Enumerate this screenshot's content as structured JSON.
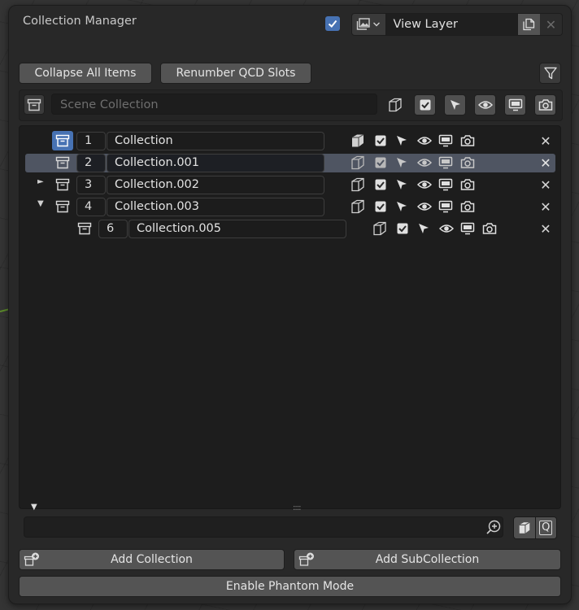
{
  "panel": {
    "title": "Collection Manager",
    "view_layer": "View Layer"
  },
  "toolbar": {
    "collapse_label": "Collapse All Items",
    "renumber_label": "Renumber QCD Slots"
  },
  "scene": {
    "label": "Scene Collection"
  },
  "rows": [
    {
      "slot": "1",
      "name": "Collection"
    },
    {
      "slot": "2",
      "name": "Collection.001"
    },
    {
      "slot": "3",
      "name": "Collection.002"
    },
    {
      "slot": "4",
      "name": "Collection.003"
    },
    {
      "slot": "6",
      "name": "Collection.005"
    }
  ],
  "footer": {
    "add_collection": "Add Collection",
    "add_subcollection": "Add SubCollection",
    "phantom": "Enable Phantom Mode",
    "grip": "::::",
    "q_label": "Q"
  },
  "colors": {
    "accent": "#4772b3",
    "selected_row": "#4f5562",
    "panel_bg": "#282828"
  }
}
